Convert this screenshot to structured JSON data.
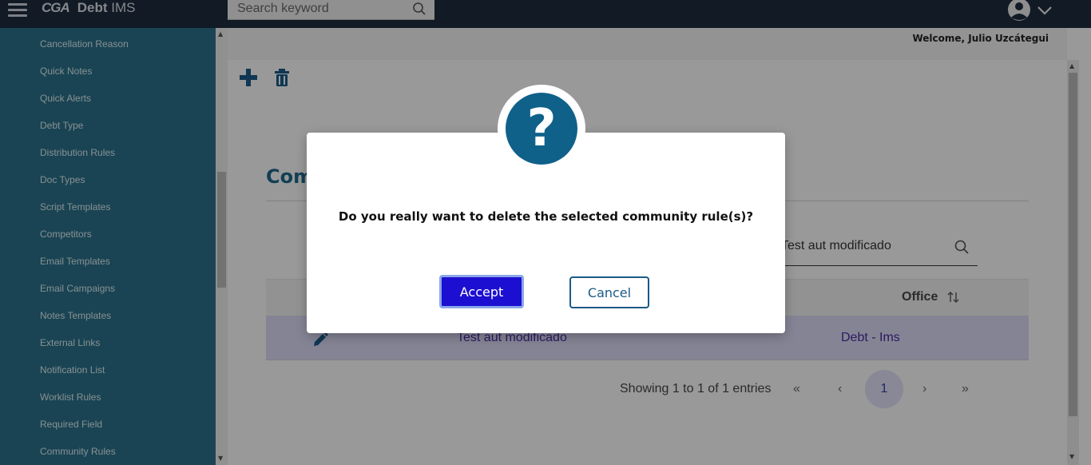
{
  "header": {
    "logo_mark": "CGA",
    "app_name": "Debt",
    "app_suffix": "IMS",
    "search_placeholder": "Search keyword"
  },
  "sidebar": {
    "items": [
      {
        "label": "Cancellation Reason"
      },
      {
        "label": "Quick Notes"
      },
      {
        "label": "Quick Alerts"
      },
      {
        "label": "Debt Type"
      },
      {
        "label": "Distribution Rules"
      },
      {
        "label": "Doc Types"
      },
      {
        "label": "Script Templates"
      },
      {
        "label": "Competitors"
      },
      {
        "label": "Email Templates"
      },
      {
        "label": "Email Campaigns"
      },
      {
        "label": "Notes Templates"
      },
      {
        "label": "External Links"
      },
      {
        "label": "Notification List"
      },
      {
        "label": "Worklist Rules"
      },
      {
        "label": "Required Field"
      },
      {
        "label": "Community Rules"
      }
    ]
  },
  "main": {
    "welcome": "Welcome, Julio Uzcátegui",
    "page_title_partial": "Com",
    "filter_value": "Test aut modificado",
    "table": {
      "office_header": "Office",
      "rows": [
        {
          "name": "Test aut modificado",
          "office": "Debt - Ims"
        }
      ]
    },
    "pagination": {
      "info": "Showing 1 to 1 of 1 entries",
      "first": "«",
      "prev": "‹",
      "current": "1",
      "next": "›",
      "last": "»"
    }
  },
  "dialog": {
    "icon": "?",
    "message": "Do you really want to delete the selected community rule(s)?",
    "accept_label": "Accept",
    "cancel_label": "Cancel"
  },
  "colors": {
    "topbar": "#1e2a3e",
    "sidebar": "#2b6e87",
    "accent": "#0f618a",
    "accept_button": "#1c0fd1"
  }
}
